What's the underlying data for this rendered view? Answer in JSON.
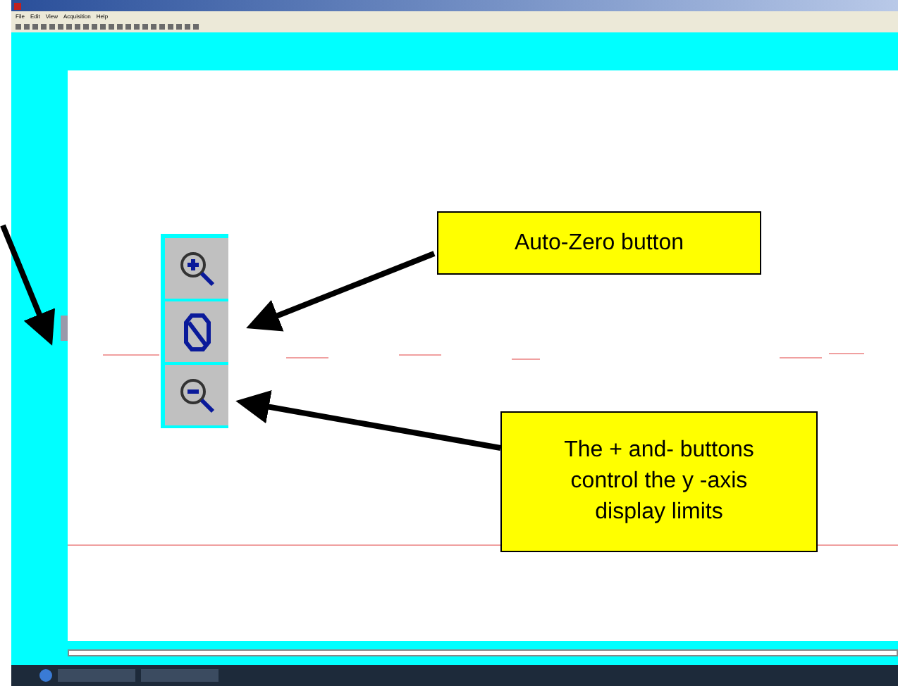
{
  "menu": [
    "File",
    "Edit",
    "View",
    "Acquisition",
    "Help"
  ],
  "callouts": [
    {
      "text": "Auto-Zero button"
    },
    {
      "text": "The + and- buttons control the y -axis display limits"
    }
  ]
}
